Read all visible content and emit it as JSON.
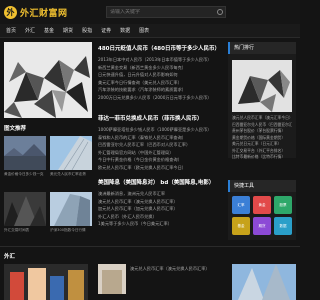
{
  "logo": {
    "mark": "外",
    "text": "外汇财富网"
  },
  "search": {
    "placeholder": "请输入关键字"
  },
  "nav": [
    "首页",
    "外汇",
    "基金",
    "期货",
    "股指",
    "证券",
    "数据",
    "图表"
  ],
  "news1": {
    "title": "480日元贬值人民币（480日币等于多少人民币）",
    "items": [
      "2013年日本中对人民币（2013年日本币值等于多少人民币）",
      "新西兰黄金交易（新西兰黄金多少人民币每克）",
      "日元快速升值，日元升值对人民币影响如何",
      "美元汇率今日行情查询（美元兑人民币汇率）",
      "汽车涂装的技能要求（汽车涂装师的素质要求）",
      "2000万日元兑换多少人民币（2000万日元等于多少人民币）"
    ]
  },
  "news2": {
    "title": "菲达一菲币兑换成人民币（菲币换人民币）",
    "items": [
      "1000萨摩亚塔拉多少钱人民币（1000萨摩亚是多少人民币）",
      "泰铢和人民币的汇率（泰铢兑人民币汇率查询）",
      "巴西雷亚尔兑人民币汇率（巴西币对人民币汇率）",
      "外汇管理局官方网站（中国外汇管理局）",
      "今日中行黄金价格（今日金价黄金价格查询）",
      "欧元兑人民币汇率（欧元兑换人民币汇率今日）"
    ]
  },
  "news3": {
    "title": "美国降息（美国降息对） bd（美国降息,电影）",
    "items": [
      "澳洲最新消息，澳洲元兑人民币汇率",
      "澳元兑人民币汇率（澳元兑换人民币汇率）",
      "加元兑人民币汇率（加元兑换人民币汇率）",
      "外汇人民币（外汇人民币兑换）",
      "1美元等于多少人民币（今日美元汇率）"
    ]
  },
  "hot": {
    "title": "热门排行",
    "items": [
      "澳元兑人民币汇率（澳元汇率今日）",
      "巴西雷亚尔兑人民币（巴西雷亚尔汇率）",
      "贵州茅台股价（茅台股票行情）",
      "黄金期货价格（国际黄金期货）",
      "美元兑日元汇率（日元汇率）",
      "外汇交易平台（外汇平台排名）",
      "比特币最新价格（比特币行情）"
    ]
  },
  "gallery": {
    "title": "图文推荐",
    "thumbs": [
      {
        "caption": "黄金价格今日多少钱一克"
      },
      {
        "caption": "美元兑人民币汇率走势"
      },
      {
        "caption": "外汇交易时间表"
      },
      {
        "caption": "沪深300指数今日行情"
      }
    ]
  },
  "tools": {
    "title": "快捷工具",
    "items": [
      {
        "label": "汇率",
        "color": "#3b7fd6"
      },
      {
        "label": "黄金",
        "color": "#e24a4a"
      },
      {
        "label": "股票",
        "color": "#2ea86a"
      },
      {
        "label": "基金",
        "color": "#c7a21a"
      },
      {
        "label": "期货",
        "color": "#8c4ad6"
      },
      {
        "label": "数据",
        "color": "#2a9fc9"
      }
    ]
  },
  "foreign": {
    "title": "外汇",
    "news": "澳元兑人民币汇率（澳元兑换人民币汇率）"
  }
}
